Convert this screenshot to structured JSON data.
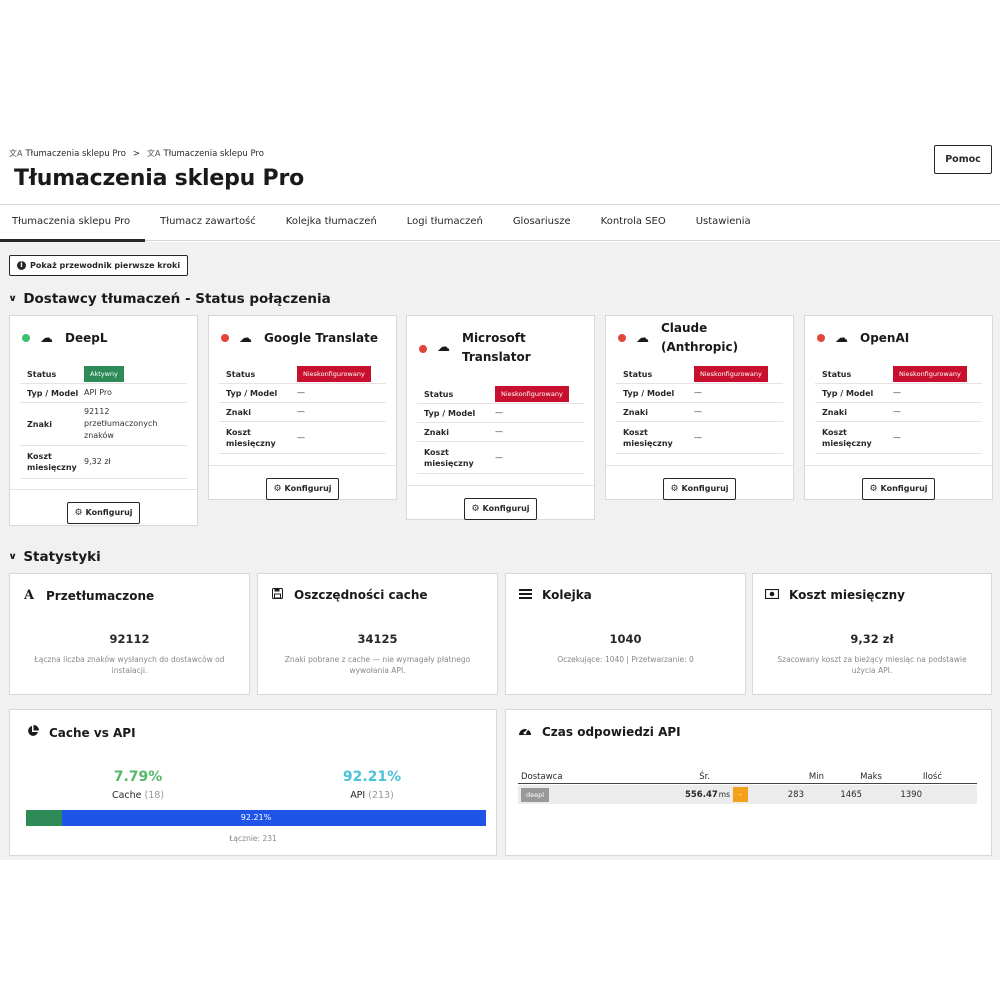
{
  "breadcrumb": [
    {
      "icon": "translate-icon",
      "label": "Tłumaczenia sklepu Pro"
    },
    {
      "icon": "translate-icon",
      "label": "Tłumaczenia sklepu Pro"
    }
  ],
  "breadcrumb_separator": ">",
  "page_title": "Tłumaczenia sklepu Pro",
  "help_label": "Pomoc",
  "tabs": [
    {
      "label": "Tłumaczenia sklepu Pro",
      "active": true
    },
    {
      "label": "Tłumacz zawartość",
      "active": false
    },
    {
      "label": "Kolejka tłumaczeń",
      "active": false
    },
    {
      "label": "Logi tłumaczeń",
      "active": false
    },
    {
      "label": "Glosariusze",
      "active": false
    },
    {
      "label": "Kontrola SEO",
      "active": false
    },
    {
      "label": "Ustawienia",
      "active": false
    }
  ],
  "guide_button": "Pokaż przewodnik pierwsze kroki",
  "providers_section": {
    "title": "Dostawcy tłumaczeń - Status połączenia",
    "labels": {
      "status": "Status",
      "model": "Typ / Model",
      "chars": "Znaki",
      "cost": "Koszt miesięczny"
    },
    "configure_label": "Konfiguruj",
    "providers": [
      {
        "name": "DeepL",
        "online": true,
        "status": "Aktywny",
        "model": "API Pro",
        "chars": "92112 przetłumaczonych znaków",
        "cost": "9,32 zł"
      },
      {
        "name": "Google Translate",
        "online": false,
        "status": "Nieskonfigurowany",
        "model": "—",
        "chars": "—",
        "cost": "—"
      },
      {
        "name": "Microsoft Translator",
        "online": false,
        "status": "Nieskonfigurowany",
        "model": "—",
        "chars": "—",
        "cost": "—"
      },
      {
        "name": "Claude (Anthropic)",
        "online": false,
        "status": "Nieskonfigurowany",
        "model": "—",
        "chars": "—",
        "cost": "—"
      },
      {
        "name": "OpenAI",
        "online": false,
        "status": "Nieskonfigurowany",
        "model": "—",
        "chars": "—",
        "cost": "—"
      }
    ]
  },
  "stats_section": {
    "title": "Statystyki",
    "cards": [
      {
        "icon": "font-icon",
        "title": "Przetłumaczone",
        "value": "92112",
        "desc": "Łączna liczba znaków wysłanych do dostawców od instalacji."
      },
      {
        "icon": "save-icon",
        "title": "Oszczędności cache",
        "value": "34125",
        "desc": "Znaki pobrane z cache — nie wymagały płatnego wywołania API."
      },
      {
        "icon": "list-icon",
        "title": "Kolejka",
        "value": "1040",
        "desc": "Oczekujące: 1040 | Przetwarzanie: 0"
      },
      {
        "icon": "money-icon",
        "title": "Koszt miesięczny",
        "value": "9,32 zł",
        "desc": "Szacowany koszt za bieżący miesiąc na podstawie użycia API."
      }
    ]
  },
  "cache_vs_api": {
    "title": "Cache vs API",
    "cache_pct": "7.79%",
    "cache_label": "Cache",
    "cache_count": "(18)",
    "api_pct": "92.21%",
    "api_label": "API",
    "api_count": "(213)",
    "cache_fraction": 0.0779,
    "bar_label": "92.21%",
    "total": "Łącznie: 231",
    "colors": {
      "cache": "#2e8b57",
      "api": "#1f54e8"
    }
  },
  "api_time": {
    "title": "Czas odpowiedzi API",
    "columns": [
      "Dostawca",
      "Śr.",
      "Min",
      "Maks",
      "Ilość"
    ],
    "rows": [
      {
        "provider": "deepl",
        "avg": "556.47",
        "unit": "ms",
        "warn": "–",
        "min": "283",
        "max": "1465",
        "count": "1390"
      }
    ]
  }
}
